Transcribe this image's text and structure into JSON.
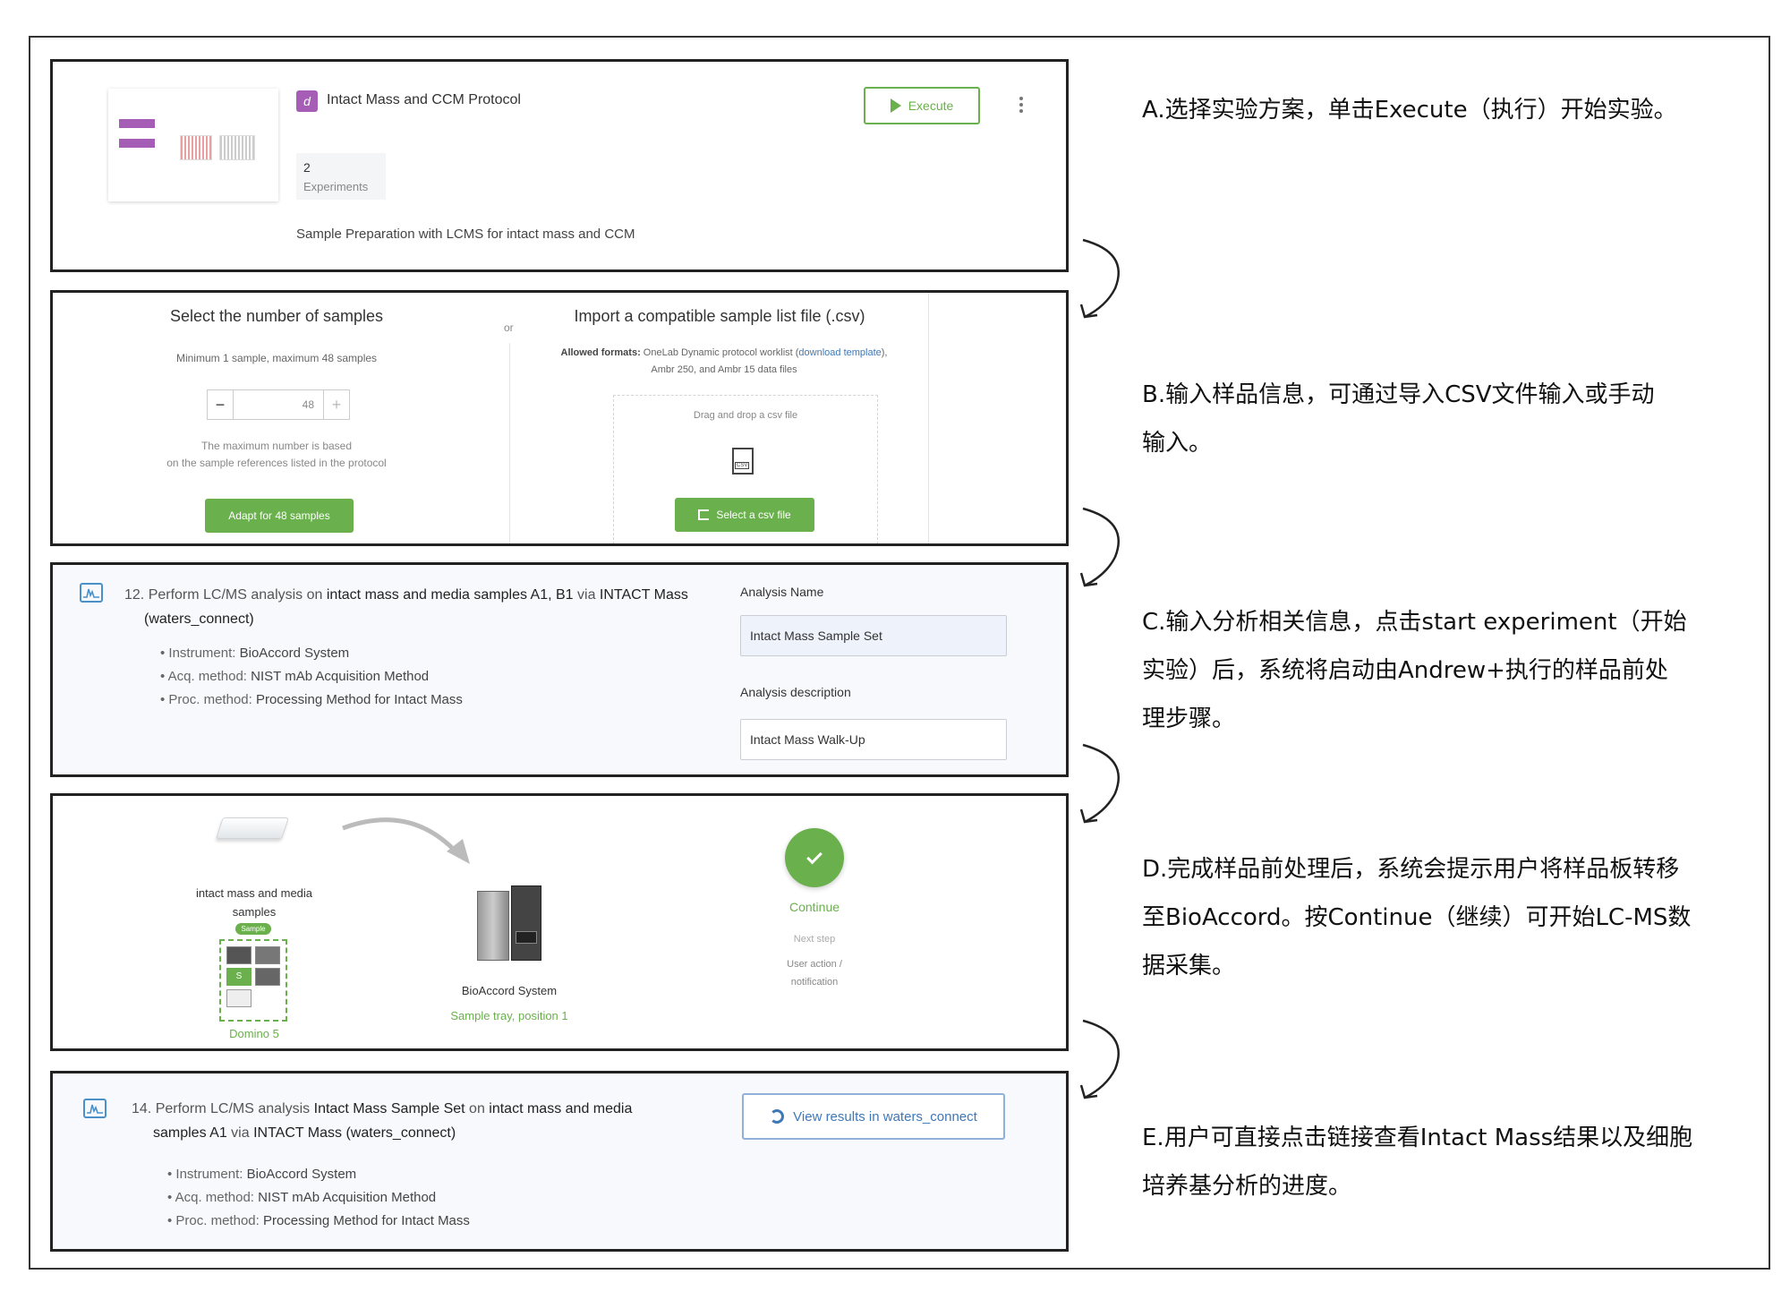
{
  "panel1": {
    "protocol_badge": "d",
    "protocol_title": "Intact Mass and CCM Protocol",
    "execute_label": "Execute",
    "experiments_count": "2",
    "experiments_label": "Experiments",
    "description": "Sample Preparation with LCMS for intact mass and CCM"
  },
  "panel2": {
    "left_title": "Select the number of samples",
    "left_subtitle": "Minimum 1 sample, maximum 48 samples",
    "stepper_value": "48",
    "note_line1": "The maximum number is based",
    "note_line2": "on the sample references listed in the protocol",
    "adapt_label": "Adapt for 48 samples",
    "or_label": "or",
    "right_title": "Import a compatible sample list file (.csv)",
    "allowed_label": "Allowed formats:",
    "allowed_text1": "OneLab Dynamic protocol worklist (",
    "download_link": "download template",
    "allowed_text1_end": "),",
    "allowed_text2": "Ambr 250, and Ambr 15 data files",
    "drop_label": "Drag and drop a csv file",
    "csv_icon_text": "CSV",
    "select_label": "Select a csv file"
  },
  "panel3": {
    "step_prefix": "12. Perform LC/MS analysis on ",
    "step_bold1": "intact mass and media samples A1, B1",
    "step_via": " via ",
    "step_bold2": "INTACT Mass",
    "step_line2": "(waters_connect)",
    "instrument_key": "Instrument: ",
    "instrument_val": "BioAccord System",
    "acq_key": "Acq. method: ",
    "acq_val": "NIST mAb Acquisition Method",
    "proc_key": "Proc. method: ",
    "proc_val": "Processing Method for Intact Mass",
    "analysis_name_label": "Analysis Name",
    "analysis_name_value": "Intact Mass Sample Set",
    "analysis_desc_label": "Analysis description",
    "analysis_desc_value": "Intact Mass Walk-Up"
  },
  "panel4": {
    "samples_label_line1": "intact mass and media",
    "samples_label_line2": "samples",
    "sample_tag": "Sample",
    "domino_letter": "S",
    "domino_label": "Domino 5",
    "instrument_label": "BioAccord System",
    "tray_label": "Sample tray, position 1",
    "continue_label": "Continue",
    "next_step_label": "Next step",
    "user_action_line1": "User action /",
    "user_action_line2": "notification"
  },
  "panel5": {
    "step_prefix": "14. Perform LC/MS analysis ",
    "step_bold1": "Intact Mass Sample Set",
    "step_on": " on ",
    "step_bold2": "intact mass and media",
    "step_line2_bold": "samples A1",
    "step_line2_via": " via ",
    "step_line2_bold2": "INTACT Mass (waters_connect)",
    "instrument_key": "Instrument: ",
    "instrument_val": "BioAccord System",
    "acq_key": "Acq. method: ",
    "acq_val": "NIST mAb Acquisition Method",
    "proc_key": "Proc. method: ",
    "proc_val": "Processing Method for Intact Mass",
    "view_results_label": "View results in waters_connect"
  },
  "annotations": {
    "a": "A.选择实验方案，单击Execute（执行）开始实验。",
    "b_line1": "B.输入样品信息，可通过导入CSV文件输入或手动",
    "b_line2": "输入。",
    "c_line1": "C.输入分析相关信息，点击start experiment（开始",
    "c_line2": "实验）后，系统将启动由Andrew+执行的样品前处",
    "c_line3": "理步骤。",
    "d_line1": "D.完成样品前处理后，系统会提示用户将样品板转移",
    "d_line2": "至BioAccord。按Continue（继续）可开始LC-MS数",
    "d_line3": "据采集。",
    "e_line1": "E.用户可直接点击链接查看Intact Mass结果以及细胞",
    "e_line2": "培养基分析的进度。"
  },
  "colors": {
    "accent_green": "#6ab04c",
    "purple": "#a55db5",
    "link_blue": "#3f78b8",
    "continue_green": "#6ab04c"
  }
}
